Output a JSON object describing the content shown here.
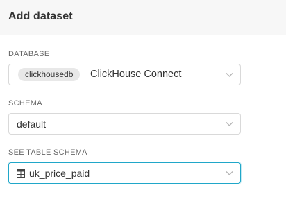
{
  "header": {
    "title": "Add dataset"
  },
  "database": {
    "label": "DATABASE",
    "badge": "clickhousedb",
    "value": "ClickHouse Connect"
  },
  "schema": {
    "label": "SCHEMA",
    "value": "default"
  },
  "table": {
    "label": "SEE TABLE SCHEMA",
    "value": "uk_price_paid",
    "icon": "table-icon"
  },
  "colors": {
    "accent": "#20a7c9",
    "border": "#d9d9d9",
    "header_bg": "#f7f7f7",
    "badge_bg": "#e8e8e8"
  }
}
